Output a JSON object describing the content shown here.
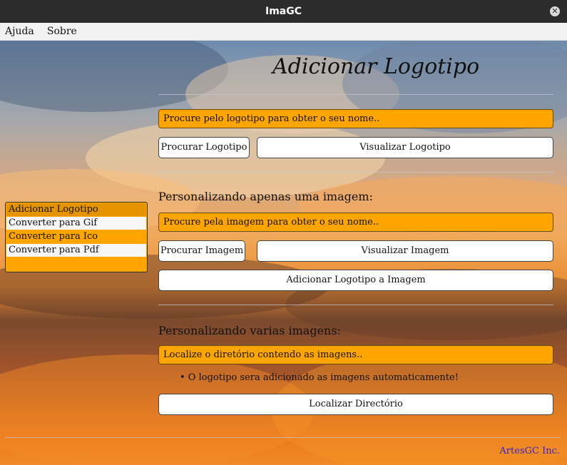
{
  "window": {
    "title": "ImaGC"
  },
  "menu": {
    "items": [
      "Ajuda",
      "Sobre"
    ]
  },
  "page": {
    "title": "Adicionar Logotipo"
  },
  "logo_section": {
    "field_text": "Procure pelo logotipo para obter o seu nome..",
    "browse_label": "Procurar Logotipo",
    "view_label": "Visualizar Logotipo"
  },
  "single_section": {
    "heading": "Personalizando apenas uma imagem:",
    "field_text": "Procure pela imagem para obter o seu nome..",
    "browse_label": "Procurar Imagem",
    "view_label": "Visualizar Imagem",
    "add_label": "Adicionar Logotipo a Imagem"
  },
  "multi_section": {
    "heading": "Personalizando varias imagens:",
    "field_text": "Localize o diretório contendo as imagens..",
    "note": "• O logotipo sera adicionado as imagens automaticamente!",
    "locate_label": "Localizar Directório"
  },
  "sidebar": {
    "items": [
      {
        "label": "Adicionar Logotipo",
        "selected": true
      },
      {
        "label": "Converter para Gif"
      },
      {
        "label": "Converter para Ico"
      },
      {
        "label": "Converter para Pdf"
      }
    ]
  },
  "footer": {
    "text": "ArtesGC Inc."
  },
  "colors": {
    "accent": "#ffa500",
    "footer_text": "#3a24c8"
  }
}
